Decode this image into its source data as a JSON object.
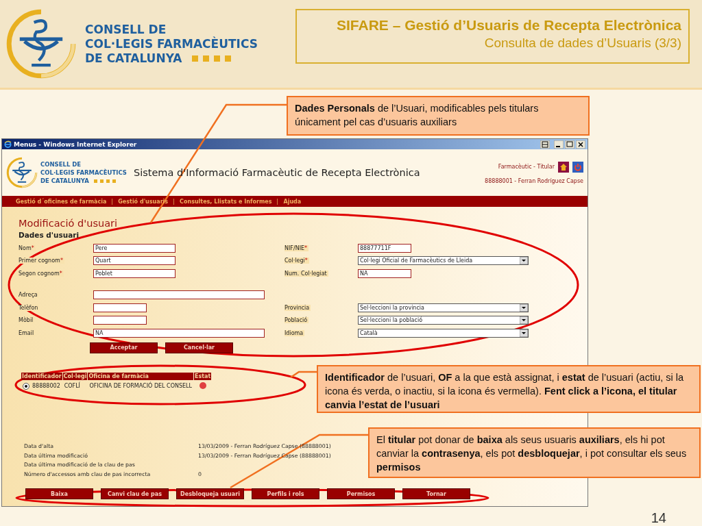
{
  "slide": {
    "logo_lines": [
      "CONSELL DE",
      "COL·LEGIS FARMACÈUTICS",
      "DE CATALUNYA"
    ],
    "title": "SIFARE – Gestió d’Usuaris de Recepta Electrònica",
    "subtitle": "Consulta de dades d’Usuaris (3/3)",
    "page_number": "14"
  },
  "callouts": [
    {
      "text": "**Dades Personals** de l’Usuari, modificables pels titulars únicament pel cas d’usuaris auxiliars"
    },
    {
      "text": "**Identificador** de l’usuari, **OF** a la que està assignat, i **estat** de l’usuari (actiu, si la icona és verda, o inactiu, si la icona és vermella). **Fent click a l’icona, el titular canvia l’estat de l’usuari**"
    },
    {
      "text": "El **titular** pot donar de **baixa** als seus usuaris **auxiliars**, els hi pot canviar la **contrasenya**, els pot **desbloquejar**, i pot consultar els seus **permisos**"
    }
  ],
  "window": {
    "title": "Menus - Windows Internet Explorer",
    "app": {
      "logo_lines": [
        "CONSELL DE",
        "COL·LEGIS FARMACÈUTICS",
        "DE CATALUNYA"
      ],
      "title": "Sistema d'Informació Farmacèutic de Recepta Electrònica",
      "role": "Farmacèutic - Titular",
      "user": "88888001 - Ferran Rodríguez Capse",
      "menu": [
        "Gestió d´oficines de farmàcia",
        "Gestió d'usuaris",
        "Consultes, Llistats e Informes",
        "Ajuda"
      ],
      "form_title": "Modificació d'usuari",
      "section": "Dades d'usuari",
      "fields_top": {
        "left": [
          {
            "label": "Nom",
            "mark": "*",
            "kind": "text",
            "value": "Pere"
          },
          {
            "label": "Primer cognom",
            "mark": "*",
            "kind": "text",
            "value": "Quart"
          },
          {
            "label": "Segon cognom",
            "mark": "*",
            "kind": "text",
            "value": "Poblet"
          }
        ],
        "right": [
          {
            "label": "NIF/NIE",
            "mark": "*",
            "kind": "text",
            "value": "88877711F"
          },
          {
            "label": "Col·legi",
            "mark": "*",
            "kind": "select",
            "value": "Col·legi Oficial de Farmacèutics de Lleida"
          },
          {
            "label": "Num. Col·legiat",
            "kind": "text",
            "value": "NA"
          }
        ]
      },
      "fields_bottom": {
        "left": [
          {
            "label": "Adreça",
            "kind": "text"
          },
          {
            "label": "Telèfon",
            "kind": "text"
          },
          {
            "label": "Mòbil",
            "kind": "text"
          },
          {
            "label": "Email",
            "kind": "text",
            "value": "NA"
          }
        ],
        "right": [
          {
            "label": "Provincia",
            "kind": "select",
            "value": "Sel·leccioni la provincia"
          },
          {
            "label": "Població",
            "kind": "select",
            "value": "Sel·leccioni la població"
          },
          {
            "label": "Idioma",
            "kind": "select",
            "value": "Català"
          }
        ]
      },
      "form_buttons": [
        "Acceptar",
        "Cancel·lar"
      ],
      "table": {
        "columns": [
          "Identificador",
          "Col·legi",
          "Oficina de farmàcia",
          "Estat"
        ],
        "rows": [
          {
            "selected": true,
            "cells": [
              "88888002",
              "COFLÍ",
              "OFICINA DE FORMACIÓ DEL CONSELL"
            ],
            "color": "#e04040"
          }
        ]
      },
      "info": [
        {
          "label": "Data d'alta",
          "value": "13/03/2009 - Ferran Rodríguez Capse (88888001)"
        },
        {
          "label": "Data última modificació",
          "value": "13/03/2009 - Ferran Rodríguez Capse (88888001)"
        },
        {
          "label": "Data última modificació de la clau de pas"
        },
        {
          "label": "Número d'accessos amb clau de pas incorrecta",
          "value": "0"
        }
      ],
      "actions": [
        "Baixa",
        "Canvi clau de pas",
        "Desbloqueja usuari",
        "Perfils i rols",
        "Permisos",
        "Tornar"
      ]
    }
  }
}
